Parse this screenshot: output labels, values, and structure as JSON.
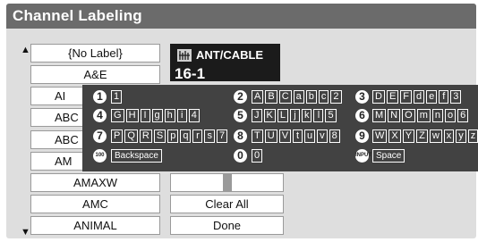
{
  "window": {
    "title": "Channel Labeling"
  },
  "list": {
    "up_arrow": "▲",
    "down_arrow": "▼",
    "items": [
      "{No Label}",
      "A&E",
      "AI",
      "ABC",
      "ABC",
      "AM",
      "AMAXW",
      "AMC",
      "ANIMAL"
    ]
  },
  "input": {
    "source_label": "ANT/CABLE",
    "channel": "16-1"
  },
  "right_buttons": {
    "clear_all": "Clear All",
    "done": "Done"
  },
  "keypad": {
    "rows": [
      [
        {
          "num": "1",
          "keys": [
            "1"
          ]
        },
        {
          "num": "2",
          "keys": [
            "A",
            "B",
            "C",
            "a",
            "b",
            "c",
            "2"
          ]
        },
        {
          "num": "3",
          "keys": [
            "D",
            "E",
            "F",
            "d",
            "e",
            "f",
            "3"
          ]
        }
      ],
      [
        {
          "num": "4",
          "keys": [
            "G",
            "H",
            "I",
            "g",
            "h",
            "i",
            "4"
          ]
        },
        {
          "num": "5",
          "keys": [
            "J",
            "K",
            "L",
            "j",
            "k",
            "l",
            "5"
          ]
        },
        {
          "num": "6",
          "keys": [
            "M",
            "N",
            "O",
            "m",
            "n",
            "o",
            "6"
          ]
        }
      ],
      [
        {
          "num": "7",
          "keys": [
            "P",
            "Q",
            "R",
            "S",
            "p",
            "q",
            "r",
            "s",
            "7"
          ]
        },
        {
          "num": "8",
          "keys": [
            "T",
            "U",
            "V",
            "t",
            "u",
            "v",
            "8"
          ]
        },
        {
          "num": "9",
          "keys": [
            "W",
            "X",
            "Y",
            "Z",
            "w",
            "x",
            "y",
            "z",
            "9"
          ]
        }
      ]
    ],
    "bottom": {
      "hundred_icon": "100",
      "backspace": "Backspace",
      "zero_num": "0",
      "zero_key": "0",
      "input_icon": "INPUT",
      "space": "Space"
    }
  }
}
